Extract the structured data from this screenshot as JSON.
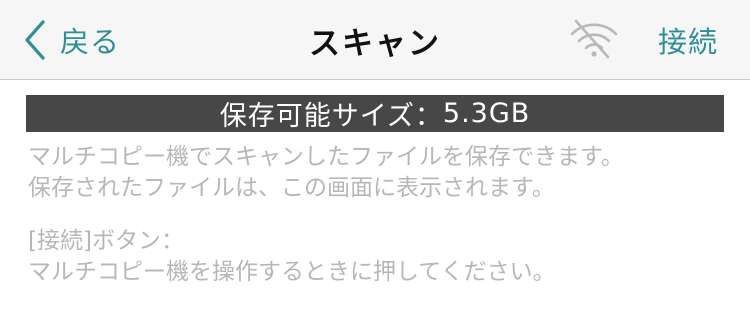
{
  "nav": {
    "back_label": "戻る",
    "title": "スキャン",
    "wifi_icon": "wifi-off-icon",
    "connect_label": "接続"
  },
  "storage": {
    "label": "保存可能サイズ",
    "separator": "：",
    "value": "5.3GB"
  },
  "description": {
    "line1": "マルチコピー機でスキャンしたファイルを保存できます。",
    "line2": "保存されたファイルは、この画面に表示されます。",
    "line3": "[接続]ボタン：",
    "line4": "マルチコピー機を操作するときに押してください。"
  },
  "colors": {
    "accent": "#2f8f95",
    "nav_background": "#f6f6f7",
    "storage_bar": "#474747",
    "hint_text": "#b7b7b7"
  }
}
